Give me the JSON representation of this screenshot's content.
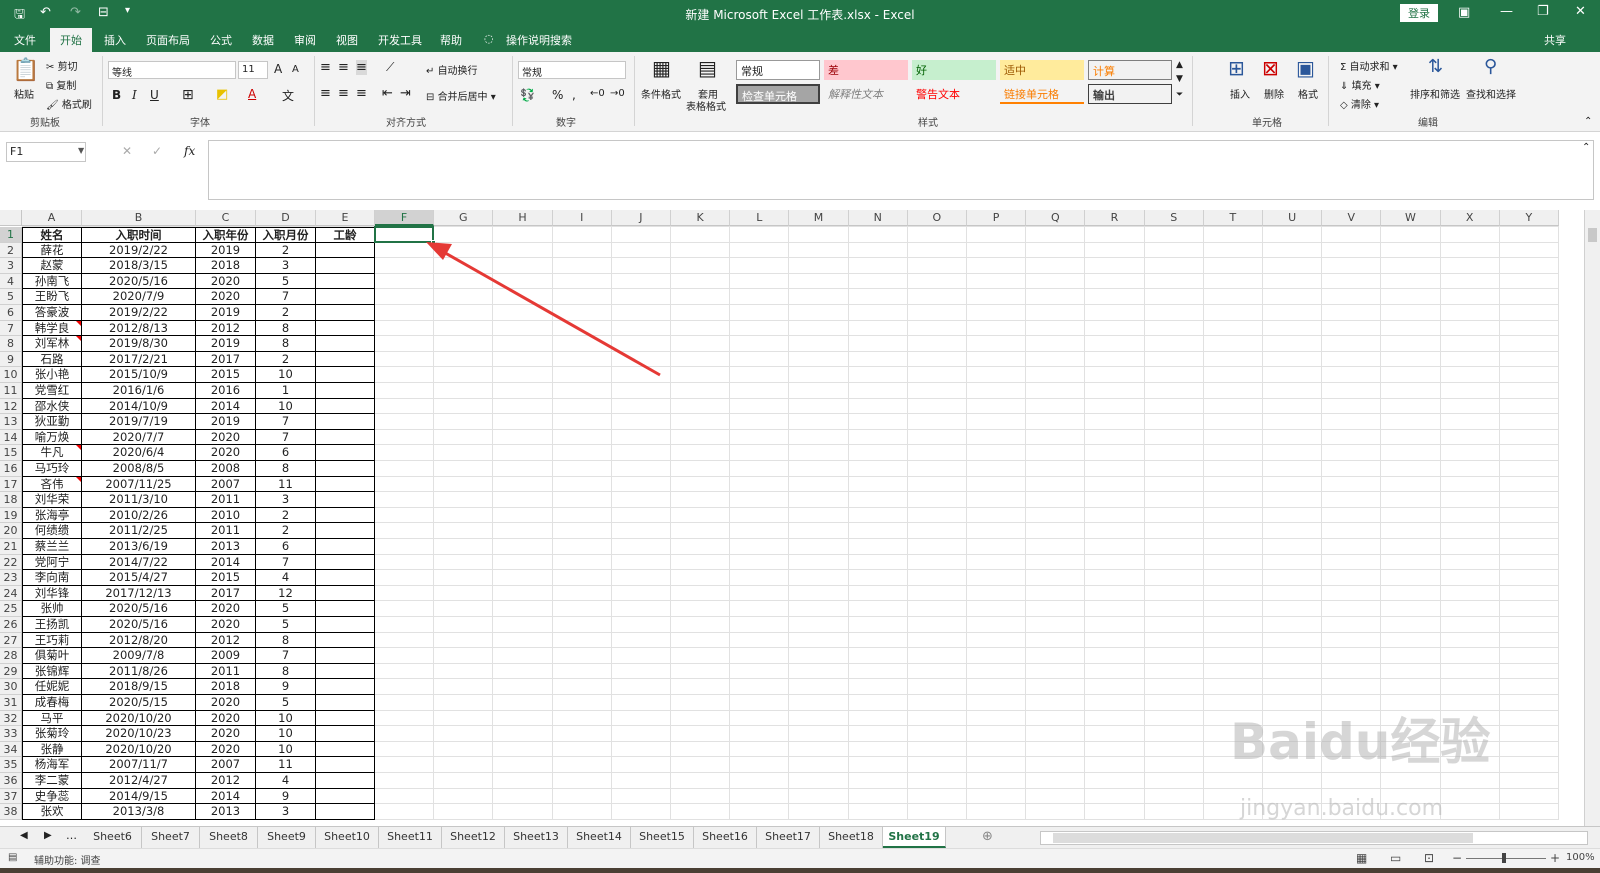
{
  "window": {
    "title": "新建 Microsoft Excel 工作表.xlsx  -  Excel",
    "login": "登录"
  },
  "tabs": [
    "文件",
    "开始",
    "插入",
    "页面布局",
    "公式",
    "数据",
    "审阅",
    "视图",
    "开发工具",
    "帮助"
  ],
  "active_tab": "开始",
  "tell_me": "操作说明搜索",
  "share": "共享",
  "ribbon": {
    "clipboard": {
      "paste": "粘贴",
      "cut": "剪切",
      "copy": "复制",
      "format_painter": "格式刷",
      "label": "剪贴板"
    },
    "font": {
      "name": "等线",
      "size": "11",
      "bold": "B",
      "italic": "I",
      "underline": "U",
      "grow": "A",
      "shrink": "A",
      "font_color_glyph": "A",
      "label": "字体"
    },
    "alignment": {
      "wrap": "自动换行",
      "merge": "合并后居中",
      "label": "对齐方式"
    },
    "number": {
      "format": "常规",
      "percent": "%",
      "comma": ",",
      "label": "数字"
    },
    "styles": {
      "cond": "条件格式",
      "table_l1": "套用",
      "table_l2": "表格格式",
      "normal": "常规",
      "bad": "差",
      "good": "好",
      "neutral": "适中",
      "calc": "计算",
      "check": "检查单元格",
      "explain": "解释性文本",
      "warn": "警告文本",
      "link": "链接单元格",
      "output": "输出",
      "label": "样式"
    },
    "cells": {
      "insert": "插入",
      "delete": "删除",
      "format": "格式",
      "label": "单元格"
    },
    "editing": {
      "autosum": "自动求和",
      "fill": "填充",
      "clear": "清除",
      "sort": "排序和筛选",
      "find": "查找和选择",
      "label": "编辑"
    }
  },
  "formula": {
    "namebox": "F1",
    "cancel": "✕",
    "enter": "✓",
    "fx": "fx",
    "value": ""
  },
  "columns": [
    "A",
    "B",
    "C",
    "D",
    "E",
    "F",
    "G",
    "H",
    "I",
    "J",
    "K",
    "L",
    "M",
    "N",
    "O",
    "P",
    "Q",
    "R",
    "S",
    "T",
    "U",
    "V",
    "W",
    "X",
    "Y"
  ],
  "headers": [
    "姓名",
    "入职时间",
    "入职年份",
    "入职月份",
    "工龄"
  ],
  "rows": [
    [
      "薛花",
      "2019/2/22",
      "2019",
      "2"
    ],
    [
      "赵蒙",
      "2018/3/15",
      "2018",
      "3"
    ],
    [
      "孙南飞",
      "2020/5/16",
      "2020",
      "5"
    ],
    [
      "王盼飞",
      "2020/7/9",
      "2020",
      "7"
    ],
    [
      "答豪波",
      "2019/2/22",
      "2019",
      "2"
    ],
    [
      "韩学良",
      "2012/8/13",
      "2012",
      "8"
    ],
    [
      "刘军林",
      "2019/8/30",
      "2019",
      "8"
    ],
    [
      "石路",
      "2017/2/21",
      "2017",
      "2"
    ],
    [
      "张小艳",
      "2015/10/9",
      "2015",
      "10"
    ],
    [
      "党雪红",
      "2016/1/6",
      "2016",
      "1"
    ],
    [
      "邵水侠",
      "2014/10/9",
      "2014",
      "10"
    ],
    [
      "狄亚勤",
      "2019/7/19",
      "2019",
      "7"
    ],
    [
      "喻万焕",
      "2020/7/7",
      "2020",
      "7"
    ],
    [
      "牛凡",
      "2020/6/4",
      "2020",
      "6"
    ],
    [
      "马巧玲",
      "2008/8/5",
      "2008",
      "8"
    ],
    [
      "吝伟",
      "2007/11/25",
      "2007",
      "11"
    ],
    [
      "刘华荣",
      "2011/3/10",
      "2011",
      "3"
    ],
    [
      "张海亭",
      "2010/2/26",
      "2010",
      "2"
    ],
    [
      "何绩缋",
      "2011/2/25",
      "2011",
      "2"
    ],
    [
      "蔡兰兰",
      "2013/6/19",
      "2013",
      "6"
    ],
    [
      "党阿宁",
      "2014/7/22",
      "2014",
      "7"
    ],
    [
      "李向南",
      "2015/4/27",
      "2015",
      "4"
    ],
    [
      "刘华锋",
      "2017/12/13",
      "2017",
      "12"
    ],
    [
      "张帅",
      "2020/5/16",
      "2020",
      "5"
    ],
    [
      "王扬凯",
      "2020/5/16",
      "2020",
      "5"
    ],
    [
      "王巧莉",
      "2012/8/20",
      "2012",
      "8"
    ],
    [
      "俱菊叶",
      "2009/7/8",
      "2009",
      "7"
    ],
    [
      "张锦辉",
      "2011/8/26",
      "2011",
      "8"
    ],
    [
      "任妮妮",
      "2018/9/15",
      "2018",
      "9"
    ],
    [
      "成春梅",
      "2020/5/15",
      "2020",
      "5"
    ],
    [
      "马平",
      "2020/10/20",
      "2020",
      "10"
    ],
    [
      "张菊玲",
      "2020/10/23",
      "2020",
      "10"
    ],
    [
      "张静",
      "2020/10/20",
      "2020",
      "10"
    ],
    [
      "杨海军",
      "2007/11/7",
      "2007",
      "11"
    ],
    [
      "李二蒙",
      "2012/4/27",
      "2012",
      "4"
    ],
    [
      "史争蕊",
      "2014/9/15",
      "2014",
      "9"
    ],
    [
      "张欢",
      "2013/3/8",
      "2013",
      "3"
    ]
  ],
  "sheets": [
    "Sheet6",
    "Sheet7",
    "Sheet8",
    "Sheet9",
    "Sheet10",
    "Sheet11",
    "Sheet12",
    "Sheet13",
    "Sheet14",
    "Sheet15",
    "Sheet16",
    "Sheet17",
    "Sheet18",
    "Sheet19"
  ],
  "active_sheet": "Sheet19",
  "status": {
    "left": "辅助功能: 调查",
    "zoom": "100%"
  },
  "watermark": {
    "l1": "Baidu经验",
    "l2": "jingyan.baidu.com"
  },
  "colors": {
    "excel_green": "#217346",
    "arrow": "#e53935"
  }
}
